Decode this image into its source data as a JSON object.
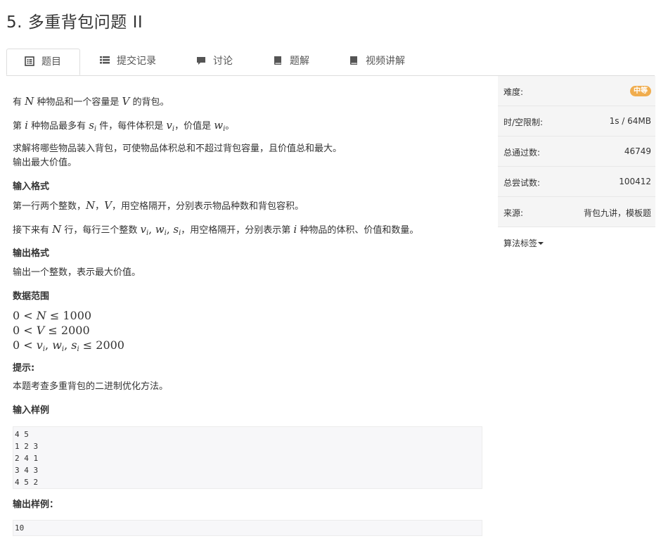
{
  "page": {
    "title": "5. 多重背包问题 II"
  },
  "tabs": [
    {
      "label": "题目",
      "icon": "list-alt-icon",
      "active": true
    },
    {
      "label": "提交记录",
      "icon": "list-icon",
      "active": false
    },
    {
      "label": "讨论",
      "icon": "comment-icon",
      "active": false
    },
    {
      "label": "题解",
      "icon": "book-icon",
      "active": false
    },
    {
      "label": "视频讲解",
      "icon": "book-icon",
      "active": false
    }
  ],
  "problem": {
    "p1": {
      "a": "有 ",
      "N": "N",
      "b": " 种物品和一个容量是 ",
      "V": "V",
      "c": " 的背包。"
    },
    "p2": {
      "a": "第 ",
      "i": "i",
      "b": " 种物品最多有 ",
      "s": "s",
      "si": "i",
      "c": " 件，每件体积是 ",
      "v": "v",
      "vi": "i",
      "d": "，价值是 ",
      "w": "w",
      "wi": "i",
      "e": "。"
    },
    "p3a": "求解将哪些物品装入背包，可使物品体积总和不超过背包容量，且价值总和最大。",
    "p3b": "输出最大价值。",
    "input_heading": "输入格式",
    "in1": {
      "a": "第一行两个整数，",
      "N": "N",
      "comma": "，",
      "V": "V",
      "b": "，用空格隔开，分别表示物品种数和背包容积。"
    },
    "in2": {
      "a": "接下来有 ",
      "N": "N",
      "b": " 行，每行三个整数 ",
      "v": "v",
      "vi": "i",
      "c1": ", ",
      "w": "w",
      "wi": "i",
      "c2": ", ",
      "s": "s",
      "si": "i",
      "c": "，用空格隔开，分别表示第 ",
      "i": "i",
      "d": " 种物品的体积、价值和数量。"
    },
    "output_heading": "输出格式",
    "out1": "输出一个整数，表示最大价值。",
    "range_heading": "数据范围",
    "r1": {
      "lead": "0 < ",
      "var": "N",
      "tail": " ≤ 1000"
    },
    "r2": {
      "lead": "0 < ",
      "var": "V",
      "tail": " ≤ 2000"
    },
    "r3": {
      "lead": "0 < ",
      "v": "v",
      "vi": "i",
      "c1": ", ",
      "w": "w",
      "wi": "i",
      "c2": ", ",
      "s": "s",
      "si": "i",
      "tail": " ≤ 2000"
    },
    "hint_heading": "提示:",
    "hint": "本题考查多重背包的二进制优化方法。",
    "sample_in_heading": "输入样例",
    "sample_in": [
      "4 5",
      "1 2 3",
      "2 4 1",
      "3 4 3",
      "4 5 2"
    ],
    "sample_out_heading": "输出样例：",
    "sample_out": [
      "10"
    ]
  },
  "sidebar": {
    "difficulty_label": "难度:",
    "difficulty_value": "中等",
    "limit_label": "时/空限制:",
    "limit_value": "1s / 64MB",
    "passed_label": "总通过数:",
    "passed_value": "46749",
    "tried_label": "总尝试数:",
    "tried_value": "100412",
    "source_label": "来源:",
    "source_value": "背包九讲，模板题",
    "tags_label": "算法标签"
  },
  "colors": {
    "badge": "#f0ad4e",
    "sidebar_bg": "#f5f5f5",
    "code_bg": "#f7f7f9"
  }
}
